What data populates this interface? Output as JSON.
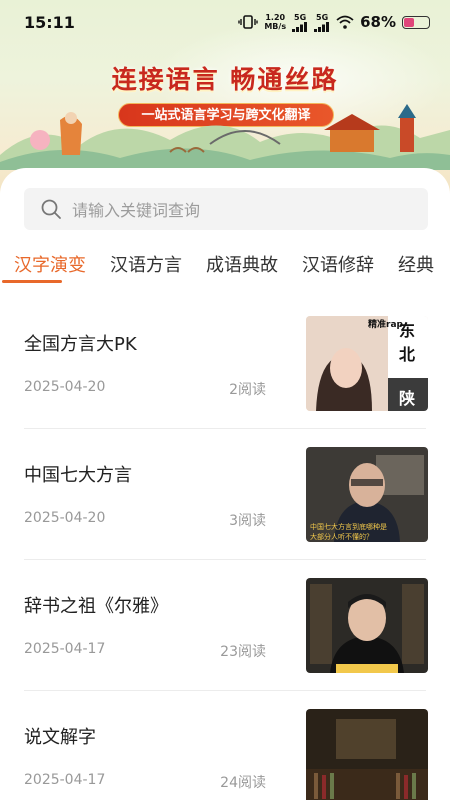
{
  "status_bar": {
    "time": "15:11",
    "net_speed_top": "1.20",
    "net_speed_bottom": "MB/s",
    "sim1": "5G",
    "sim2": "5G",
    "battery_pct": "68%",
    "battery_level": 0.4
  },
  "banner": {
    "title": "连接语言  畅通丝路",
    "subtitle": "一站式语言学习与跨文化翻译"
  },
  "search": {
    "placeholder": "请输入关键词查询"
  },
  "tabs": [
    {
      "label": "汉字演变",
      "active": true
    },
    {
      "label": "汉语方言"
    },
    {
      "label": "成语典故"
    },
    {
      "label": "汉语修辞"
    },
    {
      "label": "经典"
    }
  ],
  "articles": [
    {
      "title": "全国方言大PK",
      "date": "2025-04-20",
      "reads": "2阅读",
      "thumb_text": [
        "精准rap",
        "东",
        "北",
        "陕"
      ]
    },
    {
      "title": "中国七大方言",
      "date": "2025-04-20",
      "reads": "3阅读",
      "thumb_text": [
        "中国七大方言到底哪种是",
        "大部分人听不懂的？"
      ]
    },
    {
      "title": "辞书之祖《尔雅》",
      "date": "2025-04-17",
      "reads": "23阅读"
    },
    {
      "title": "说文解字",
      "date": "2025-04-17",
      "reads": "24阅读"
    }
  ],
  "colors": {
    "accent": "#e8682a",
    "title_red": "#c8281e",
    "pill_red": "#d8361c"
  }
}
